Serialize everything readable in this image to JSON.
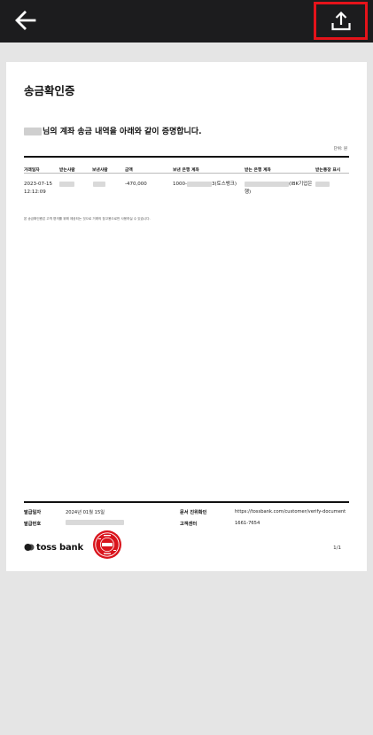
{
  "header": {
    "back_icon": "arrow-left-icon",
    "share_icon": "share-upload-icon",
    "highlight_color": "#e5131a"
  },
  "doc": {
    "title": "송금확인증",
    "statement": "님의 계좌 송금 내역을 아래와 같이 증명합니다.",
    "unit": "단위: 원",
    "columns": [
      "거래일자",
      "받는사람",
      "보낸사람",
      "금액",
      "보낸 은행 계좌",
      "받는 은행 계좌",
      "받는통장 표시"
    ],
    "row": {
      "date": "2023-07-15",
      "time": "12:12:09",
      "amount": "-470,000",
      "send_account_prefix": "1000-",
      "send_account_suffix": "3(토스뱅크)",
      "recv_account_suffix": "(IBK기업은",
      "recv_account_tail": "행)"
    },
    "notice": "본 송금확인증은 고객 편의를 위해 제공되는 것으로 거래의 참고용으로만 사용하실 수 있습니다.",
    "footer": {
      "issue_date_label": "발급일자",
      "issue_date": "2024년 01월 15일",
      "issue_no_label": "발급번호",
      "verify_label": "문서 진위확인",
      "verify_url": "https://tossbank.com/customer/verify-document",
      "center_label": "고객센터",
      "center_phone": "1661-7654",
      "brand": "toss bank",
      "page": "1/1",
      "seal_color": "#d9141c"
    }
  }
}
